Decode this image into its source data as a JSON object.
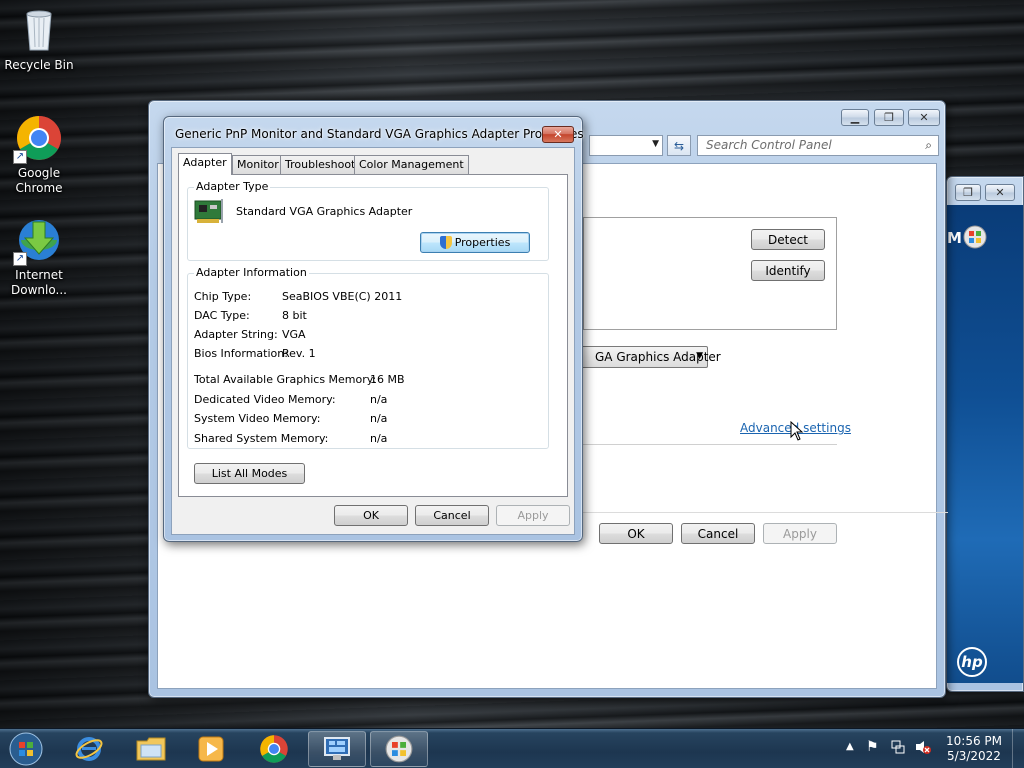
{
  "desktop": {
    "icons": [
      {
        "label": "Recycle Bin"
      },
      {
        "label": "Google Chrome"
      },
      {
        "label": "Internet Downlo..."
      }
    ]
  },
  "control_panel": {
    "search_placeholder": "Search Control Panel",
    "detect_label": "Detect",
    "identify_label": "Identify",
    "display_select": "GA Graphics Adapter",
    "advanced_link": "Advanced settings",
    "ok_label": "OK",
    "cancel_label": "Cancel",
    "apply_label": "Apply"
  },
  "right_window": {
    "partial_text": "M",
    "brand": "hp"
  },
  "dialog": {
    "title": "Generic PnP Monitor and Standard VGA Graphics Adapter Properties",
    "tabs": [
      {
        "label": "Adapter",
        "active": true
      },
      {
        "label": "Monitor",
        "active": false
      },
      {
        "label": "Troubleshoot",
        "active": false
      },
      {
        "label": "Color Management",
        "active": false
      }
    ],
    "adapter_type": {
      "title": "Adapter Type",
      "name": "Standard VGA Graphics Adapter",
      "properties_label": "Properties"
    },
    "adapter_info": {
      "title": "Adapter Information",
      "rows": [
        {
          "label": "Chip Type:",
          "value": "SeaBIOS VBE(C) 2011"
        },
        {
          "label": "DAC Type:",
          "value": "8 bit"
        },
        {
          "label": "Adapter String:",
          "value": "VGA"
        },
        {
          "label": "Bios Information:",
          "value": "Rev. 1"
        }
      ],
      "memory": [
        {
          "label": "Total Available Graphics Memory:",
          "value": "16 MB"
        },
        {
          "label": "Dedicated Video Memory:",
          "value": "n/a"
        },
        {
          "label": "System Video Memory:",
          "value": "n/a"
        },
        {
          "label": "Shared System Memory:",
          "value": "n/a"
        }
      ]
    },
    "list_all_modes_label": "List All Modes",
    "ok_label": "OK",
    "cancel_label": "Cancel",
    "apply_label": "Apply"
  },
  "taskbar": {
    "items": [
      "start-orb",
      "internet-explorer",
      "windows-explorer",
      "media-player",
      "google-chrome",
      "control-panel",
      "windows-logo"
    ],
    "time": "10:56 PM",
    "date": "5/3/2022"
  },
  "colors": {
    "link": "#1a64b0",
    "titlebar": "#b4cbe6",
    "taskbar": "#1d3650",
    "close": "#c4442c"
  }
}
